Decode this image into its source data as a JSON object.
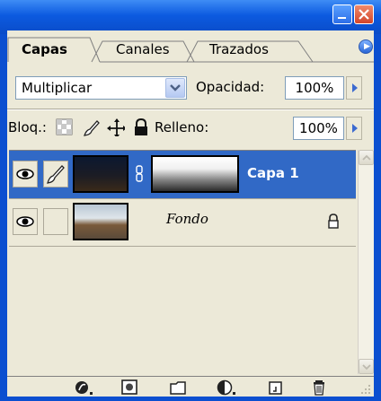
{
  "tabs": [
    {
      "label": "Capas",
      "active": true
    },
    {
      "label": "Canales",
      "active": false
    },
    {
      "label": "Trazados",
      "active": false
    }
  ],
  "blend": {
    "mode": "Multiplicar",
    "opacity_label": "Opacidad:",
    "opacity_value": "100%"
  },
  "lock": {
    "label": "Bloq.:",
    "fill_label": "Relleno:",
    "fill_value": "100%"
  },
  "layers": [
    {
      "name": "Capa 1",
      "selected": true,
      "has_mask": true
    },
    {
      "name": "Fondo",
      "selected": false,
      "locked": true
    }
  ],
  "colors": {
    "selection": "#3169c6",
    "panel": "#ece9d8",
    "titlebar": "#0a4cc8"
  },
  "toolbar_icons": [
    "link-layers-icon",
    "add-style-icon",
    "add-mask-icon",
    "new-group-icon",
    "adjustment-layer-icon",
    "new-layer-icon",
    "delete-icon"
  ]
}
